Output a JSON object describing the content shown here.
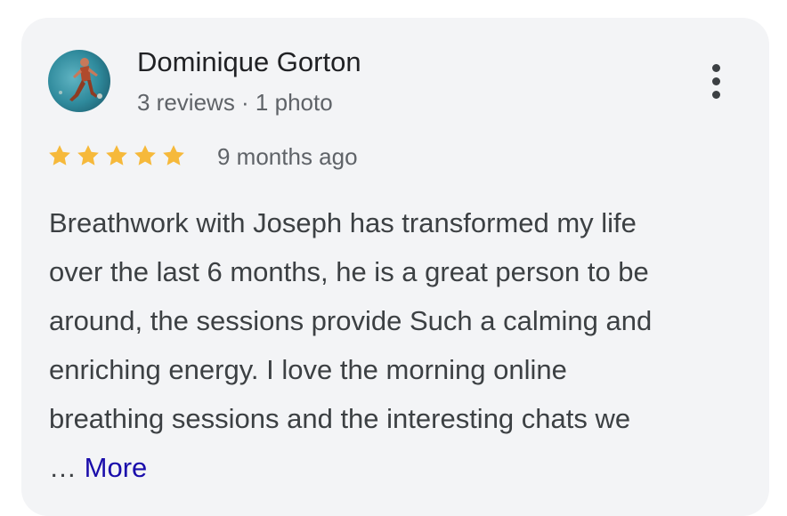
{
  "review": {
    "reviewer_name": "Dominique Gorton",
    "reviewer_meta": "3 reviews · 1 photo",
    "rating": 5,
    "rating_max": 5,
    "date": "9 months ago",
    "text_lines": [
      "Breathwork with Joseph has transformed my life",
      "over the last 6 months, he is a great person to be",
      "around, the sessions provide Such a calming and",
      "enriching energy. I love the morning online",
      "breathing sessions and the interesting chats we"
    ],
    "ellipsis": "…",
    "more_label": "More"
  },
  "icons": {
    "menu": "more-vert-icon",
    "star": "star-icon",
    "avatar": "profile-photo"
  },
  "colors": {
    "card_background": "#f3f4f6",
    "star": "#f6b93b",
    "name": "#202124",
    "secondary_text": "#5f6368",
    "body_text": "#3c4043",
    "link": "#1a0dab"
  }
}
